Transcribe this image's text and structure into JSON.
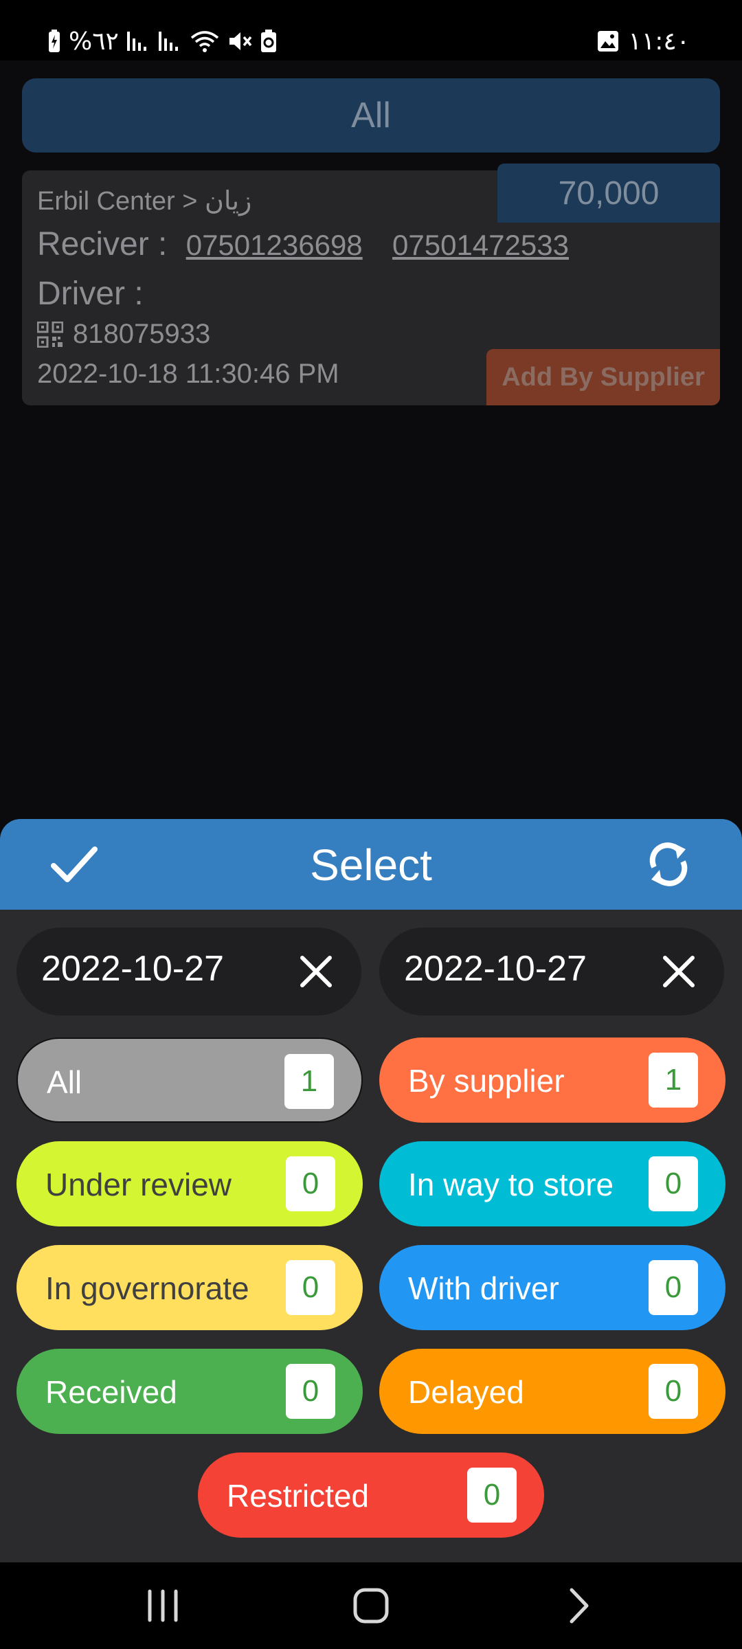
{
  "status_bar": {
    "battery_text": "%٦٢",
    "time": "١١:٤٠"
  },
  "background": {
    "filter_label": "All",
    "order": {
      "route": "Erbil Center  >  زيان",
      "price": "70,000",
      "receiver_label": "Reciver :",
      "phones": [
        "07501236698",
        "07501472533"
      ],
      "driver_label": "Driver :",
      "code": "818075933",
      "datetime": "2022-10-18 11:30:46 PM",
      "source_button": "Add By Supplier"
    }
  },
  "sheet": {
    "title": "Select",
    "from_date": "2022-10-27",
    "to_date": "2022-10-27",
    "statuses": [
      {
        "label": "All",
        "count": "1",
        "color": "#9e9e9e",
        "text_color": "#ffffff"
      },
      {
        "label": "By supplier",
        "count": "1",
        "color": "#ff7043",
        "text_color": "#ffffff"
      },
      {
        "label": "Under review",
        "count": "0",
        "color": "#d4f531",
        "text_color": "#404040"
      },
      {
        "label": "In way to store",
        "count": "0",
        "color": "#00bcd4",
        "text_color": "#ffffff"
      },
      {
        "label": "In governorate",
        "count": "0",
        "color": "#ffdf5d",
        "text_color": "#404040"
      },
      {
        "label": "With driver",
        "count": "0",
        "color": "#2196f3",
        "text_color": "#ffffff"
      },
      {
        "label": "Received",
        "count": "0",
        "color": "#4caf50",
        "text_color": "#ffffff"
      },
      {
        "label": "Delayed",
        "count": "0",
        "color": "#ff9800",
        "text_color": "#ffffff"
      },
      {
        "label": "Restricted",
        "count": "0",
        "color": "#f44336",
        "text_color": "#ffffff"
      }
    ]
  },
  "icons": {
    "confirm": "check-icon",
    "refresh": "sync-icon",
    "clear": "close-icon",
    "qr": "qr-code-icon",
    "nav_recents": "recent-apps-icon",
    "nav_home": "home-icon",
    "nav_back": "back-icon"
  }
}
